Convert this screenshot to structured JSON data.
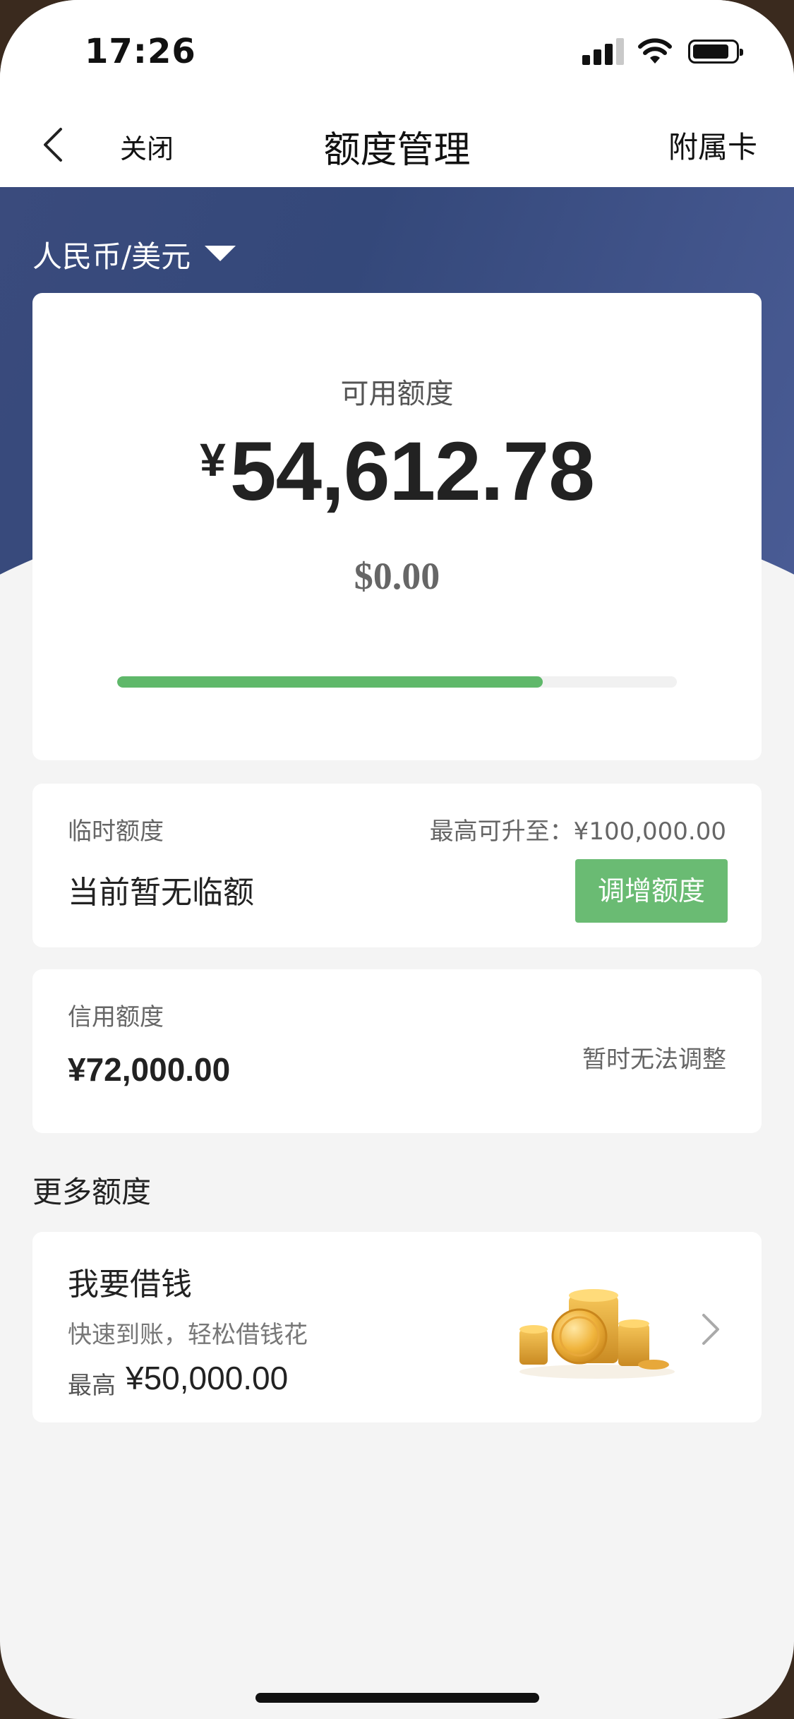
{
  "status_bar": {
    "time": "17:26"
  },
  "nav": {
    "close": "关闭",
    "title": "额度管理",
    "sub_card": "附属卡"
  },
  "currency": {
    "selected": "人民币/美元"
  },
  "available": {
    "label": "可用额度",
    "cny_symbol": "¥",
    "cny_amount": "54,612.78",
    "usd": "$0.00",
    "used_fraction": 0.76
  },
  "temp_limit": {
    "label": "临时额度",
    "max_upgrade": "最高可升至：¥100,000.00",
    "status": "当前暂无临额",
    "adjust_button": "调增额度"
  },
  "credit_limit": {
    "label": "信用额度",
    "amount": "¥72,000.00",
    "note": "暂时无法调整"
  },
  "more": {
    "section_title": "更多额度",
    "loan": {
      "title": "我要借钱",
      "subtitle": "快速到账，轻松借钱花",
      "max_label": "最高",
      "max_amount": "¥50,000.00"
    }
  },
  "colors": {
    "header_blue": "#3a4b7d",
    "progress_green": "#5fb86a",
    "button_green": "#6abb73"
  }
}
